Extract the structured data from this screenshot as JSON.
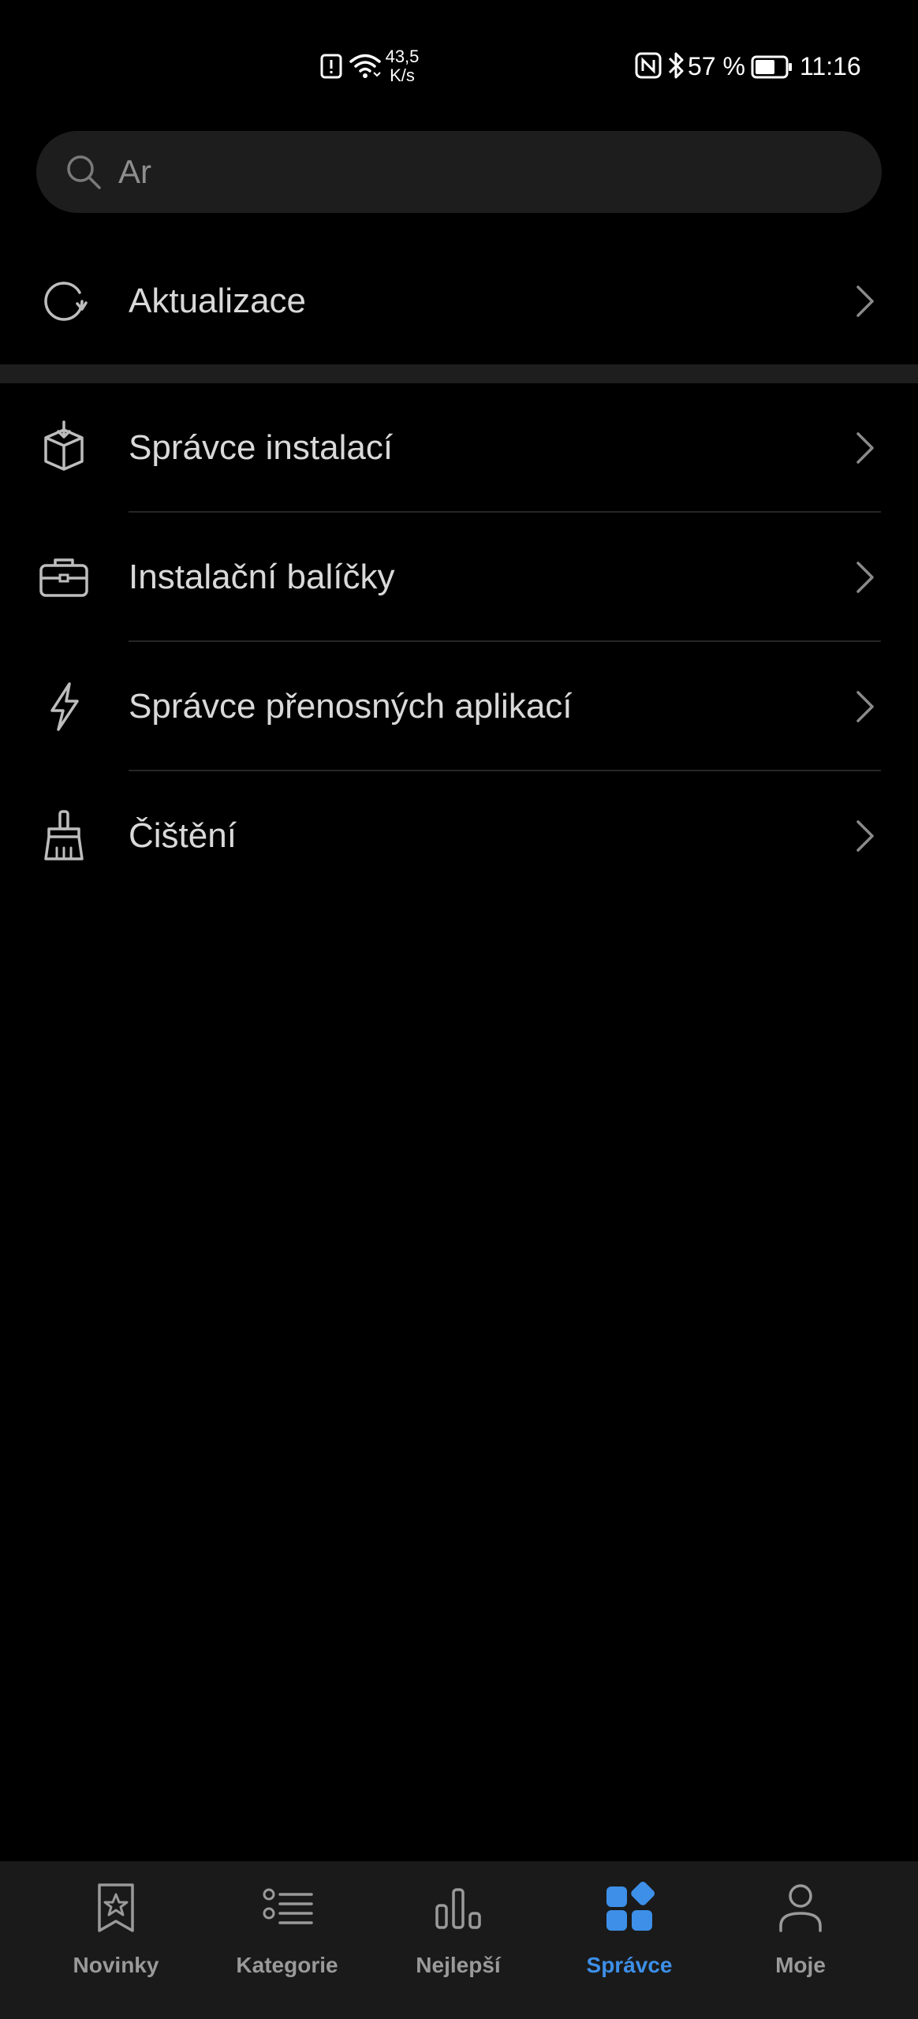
{
  "status_bar": {
    "net_speed_value": "43,5",
    "net_speed_unit": "K/s",
    "battery_percent": "57 %",
    "time": "11:16",
    "icons": [
      "alert-icon",
      "wifi-icon",
      "nfc-icon",
      "bluetooth-icon",
      "battery-icon"
    ]
  },
  "search": {
    "value": "Ar",
    "icon": "search-icon"
  },
  "sections": {
    "updates": {
      "label": "Aktualizace",
      "icon": "refresh-icon"
    },
    "tools": [
      {
        "label": "Správce instalací",
        "icon": "package-download-icon"
      },
      {
        "label": "Instalační balíčky",
        "icon": "briefcase-icon"
      },
      {
        "label": "Správce přenosných aplikací",
        "icon": "lightning-icon"
      },
      {
        "label": "Čištění",
        "icon": "broom-icon"
      }
    ]
  },
  "bottom_nav": {
    "active": "Správce",
    "items": [
      {
        "label": "Novinky",
        "icon": "star-bookmark-icon"
      },
      {
        "label": "Kategorie",
        "icon": "list-icon"
      },
      {
        "label": "Nejlepší",
        "icon": "bar-chart-icon"
      },
      {
        "label": "Správce",
        "icon": "apps-grid-icon"
      },
      {
        "label": "Moje",
        "icon": "person-icon"
      }
    ]
  },
  "colors": {
    "background": "#000000",
    "surface": "#1d1d1d",
    "text_primary": "#d9d9d9",
    "text_muted": "#9a9a9a",
    "accent": "#3d8fe8"
  }
}
